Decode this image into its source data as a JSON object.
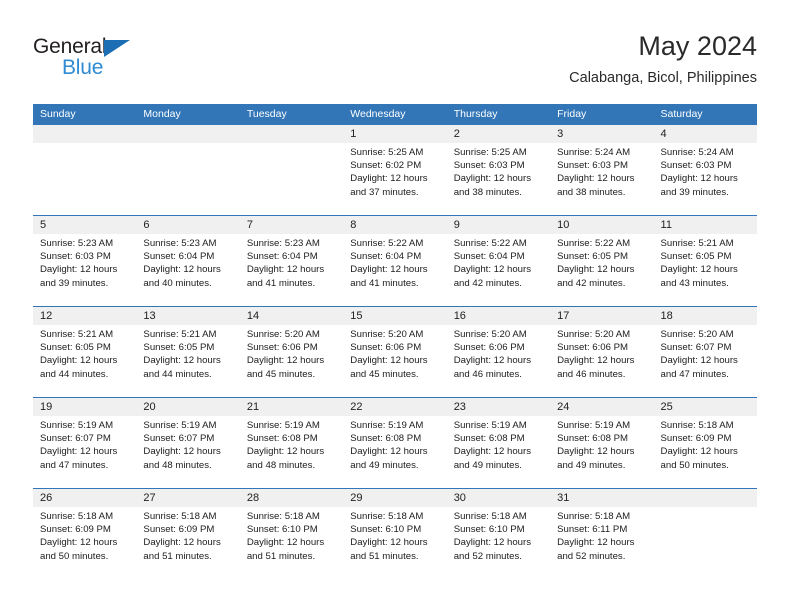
{
  "brand": {
    "name_part1": "General",
    "name_part2": "Blue",
    "color_dark": "#231f20",
    "color_blue": "#2e8bd4",
    "triangle_color": "#1c6eb4"
  },
  "header": {
    "title": "May 2024",
    "subtitle": "Calabanga, Bicol, Philippines"
  },
  "calendar": {
    "header_bg": "#3276b8",
    "number_band_bg": "#f0f0f0",
    "weekdays": [
      "Sunday",
      "Monday",
      "Tuesday",
      "Wednesday",
      "Thursday",
      "Friday",
      "Saturday"
    ],
    "weeks": [
      {
        "days": [
          {
            "number": "",
            "sunrise": "",
            "sunset": "",
            "daylight_line1": "",
            "daylight_line2": ""
          },
          {
            "number": "",
            "sunrise": "",
            "sunset": "",
            "daylight_line1": "",
            "daylight_line2": ""
          },
          {
            "number": "",
            "sunrise": "",
            "sunset": "",
            "daylight_line1": "",
            "daylight_line2": ""
          },
          {
            "number": "1",
            "sunrise": "Sunrise: 5:25 AM",
            "sunset": "Sunset: 6:02 PM",
            "daylight_line1": "Daylight: 12 hours",
            "daylight_line2": "and 37 minutes."
          },
          {
            "number": "2",
            "sunrise": "Sunrise: 5:25 AM",
            "sunset": "Sunset: 6:03 PM",
            "daylight_line1": "Daylight: 12 hours",
            "daylight_line2": "and 38 minutes."
          },
          {
            "number": "3",
            "sunrise": "Sunrise: 5:24 AM",
            "sunset": "Sunset: 6:03 PM",
            "daylight_line1": "Daylight: 12 hours",
            "daylight_line2": "and 38 minutes."
          },
          {
            "number": "4",
            "sunrise": "Sunrise: 5:24 AM",
            "sunset": "Sunset: 6:03 PM",
            "daylight_line1": "Daylight: 12 hours",
            "daylight_line2": "and 39 minutes."
          }
        ]
      },
      {
        "days": [
          {
            "number": "5",
            "sunrise": "Sunrise: 5:23 AM",
            "sunset": "Sunset: 6:03 PM",
            "daylight_line1": "Daylight: 12 hours",
            "daylight_line2": "and 39 minutes."
          },
          {
            "number": "6",
            "sunrise": "Sunrise: 5:23 AM",
            "sunset": "Sunset: 6:04 PM",
            "daylight_line1": "Daylight: 12 hours",
            "daylight_line2": "and 40 minutes."
          },
          {
            "number": "7",
            "sunrise": "Sunrise: 5:23 AM",
            "sunset": "Sunset: 6:04 PM",
            "daylight_line1": "Daylight: 12 hours",
            "daylight_line2": "and 41 minutes."
          },
          {
            "number": "8",
            "sunrise": "Sunrise: 5:22 AM",
            "sunset": "Sunset: 6:04 PM",
            "daylight_line1": "Daylight: 12 hours",
            "daylight_line2": "and 41 minutes."
          },
          {
            "number": "9",
            "sunrise": "Sunrise: 5:22 AM",
            "sunset": "Sunset: 6:04 PM",
            "daylight_line1": "Daylight: 12 hours",
            "daylight_line2": "and 42 minutes."
          },
          {
            "number": "10",
            "sunrise": "Sunrise: 5:22 AM",
            "sunset": "Sunset: 6:05 PM",
            "daylight_line1": "Daylight: 12 hours",
            "daylight_line2": "and 42 minutes."
          },
          {
            "number": "11",
            "sunrise": "Sunrise: 5:21 AM",
            "sunset": "Sunset: 6:05 PM",
            "daylight_line1": "Daylight: 12 hours",
            "daylight_line2": "and 43 minutes."
          }
        ]
      },
      {
        "days": [
          {
            "number": "12",
            "sunrise": "Sunrise: 5:21 AM",
            "sunset": "Sunset: 6:05 PM",
            "daylight_line1": "Daylight: 12 hours",
            "daylight_line2": "and 44 minutes."
          },
          {
            "number": "13",
            "sunrise": "Sunrise: 5:21 AM",
            "sunset": "Sunset: 6:05 PM",
            "daylight_line1": "Daylight: 12 hours",
            "daylight_line2": "and 44 minutes."
          },
          {
            "number": "14",
            "sunrise": "Sunrise: 5:20 AM",
            "sunset": "Sunset: 6:06 PM",
            "daylight_line1": "Daylight: 12 hours",
            "daylight_line2": "and 45 minutes."
          },
          {
            "number": "15",
            "sunrise": "Sunrise: 5:20 AM",
            "sunset": "Sunset: 6:06 PM",
            "daylight_line1": "Daylight: 12 hours",
            "daylight_line2": "and 45 minutes."
          },
          {
            "number": "16",
            "sunrise": "Sunrise: 5:20 AM",
            "sunset": "Sunset: 6:06 PM",
            "daylight_line1": "Daylight: 12 hours",
            "daylight_line2": "and 46 minutes."
          },
          {
            "number": "17",
            "sunrise": "Sunrise: 5:20 AM",
            "sunset": "Sunset: 6:06 PM",
            "daylight_line1": "Daylight: 12 hours",
            "daylight_line2": "and 46 minutes."
          },
          {
            "number": "18",
            "sunrise": "Sunrise: 5:20 AM",
            "sunset": "Sunset: 6:07 PM",
            "daylight_line1": "Daylight: 12 hours",
            "daylight_line2": "and 47 minutes."
          }
        ]
      },
      {
        "days": [
          {
            "number": "19",
            "sunrise": "Sunrise: 5:19 AM",
            "sunset": "Sunset: 6:07 PM",
            "daylight_line1": "Daylight: 12 hours",
            "daylight_line2": "and 47 minutes."
          },
          {
            "number": "20",
            "sunrise": "Sunrise: 5:19 AM",
            "sunset": "Sunset: 6:07 PM",
            "daylight_line1": "Daylight: 12 hours",
            "daylight_line2": "and 48 minutes."
          },
          {
            "number": "21",
            "sunrise": "Sunrise: 5:19 AM",
            "sunset": "Sunset: 6:08 PM",
            "daylight_line1": "Daylight: 12 hours",
            "daylight_line2": "and 48 minutes."
          },
          {
            "number": "22",
            "sunrise": "Sunrise: 5:19 AM",
            "sunset": "Sunset: 6:08 PM",
            "daylight_line1": "Daylight: 12 hours",
            "daylight_line2": "and 49 minutes."
          },
          {
            "number": "23",
            "sunrise": "Sunrise: 5:19 AM",
            "sunset": "Sunset: 6:08 PM",
            "daylight_line1": "Daylight: 12 hours",
            "daylight_line2": "and 49 minutes."
          },
          {
            "number": "24",
            "sunrise": "Sunrise: 5:19 AM",
            "sunset": "Sunset: 6:08 PM",
            "daylight_line1": "Daylight: 12 hours",
            "daylight_line2": "and 49 minutes."
          },
          {
            "number": "25",
            "sunrise": "Sunrise: 5:18 AM",
            "sunset": "Sunset: 6:09 PM",
            "daylight_line1": "Daylight: 12 hours",
            "daylight_line2": "and 50 minutes."
          }
        ]
      },
      {
        "days": [
          {
            "number": "26",
            "sunrise": "Sunrise: 5:18 AM",
            "sunset": "Sunset: 6:09 PM",
            "daylight_line1": "Daylight: 12 hours",
            "daylight_line2": "and 50 minutes."
          },
          {
            "number": "27",
            "sunrise": "Sunrise: 5:18 AM",
            "sunset": "Sunset: 6:09 PM",
            "daylight_line1": "Daylight: 12 hours",
            "daylight_line2": "and 51 minutes."
          },
          {
            "number": "28",
            "sunrise": "Sunrise: 5:18 AM",
            "sunset": "Sunset: 6:10 PM",
            "daylight_line1": "Daylight: 12 hours",
            "daylight_line2": "and 51 minutes."
          },
          {
            "number": "29",
            "sunrise": "Sunrise: 5:18 AM",
            "sunset": "Sunset: 6:10 PM",
            "daylight_line1": "Daylight: 12 hours",
            "daylight_line2": "and 51 minutes."
          },
          {
            "number": "30",
            "sunrise": "Sunrise: 5:18 AM",
            "sunset": "Sunset: 6:10 PM",
            "daylight_line1": "Daylight: 12 hours",
            "daylight_line2": "and 52 minutes."
          },
          {
            "number": "31",
            "sunrise": "Sunrise: 5:18 AM",
            "sunset": "Sunset: 6:11 PM",
            "daylight_line1": "Daylight: 12 hours",
            "daylight_line2": "and 52 minutes."
          },
          {
            "number": "",
            "sunrise": "",
            "sunset": "",
            "daylight_line1": "",
            "daylight_line2": ""
          }
        ]
      }
    ]
  }
}
